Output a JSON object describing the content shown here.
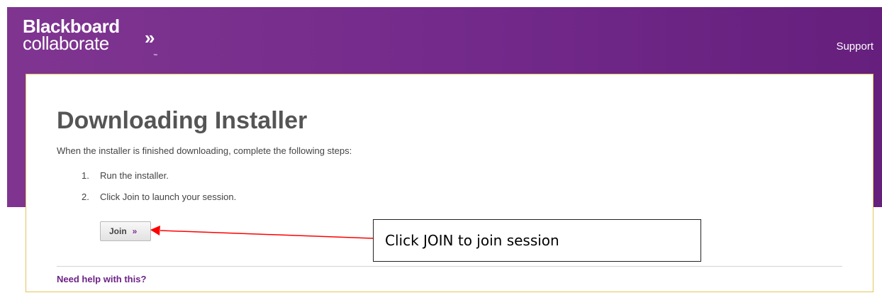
{
  "header": {
    "logo_line1": "Blackboard",
    "logo_line2": "collaborate",
    "logo_chevron": "»",
    "logo_tm": "™",
    "support_label": "Support"
  },
  "content": {
    "title": "Downloading Installer",
    "intro": "When the installer is finished downloading, complete the following steps:",
    "steps": [
      {
        "num": "1.",
        "text": "Run the installer."
      },
      {
        "num": "2.",
        "text": "Click Join to launch your session."
      }
    ],
    "join_label": "Join",
    "join_icon": "»",
    "help_link": "Need help with this?"
  },
  "annotation": {
    "callout_text": "Click JOIN to join session"
  },
  "colors": {
    "brand_purple": "#7f3590",
    "card_border": "#e6c35c",
    "link_purple": "#6c2386",
    "arrow_red": "#ff0000"
  }
}
